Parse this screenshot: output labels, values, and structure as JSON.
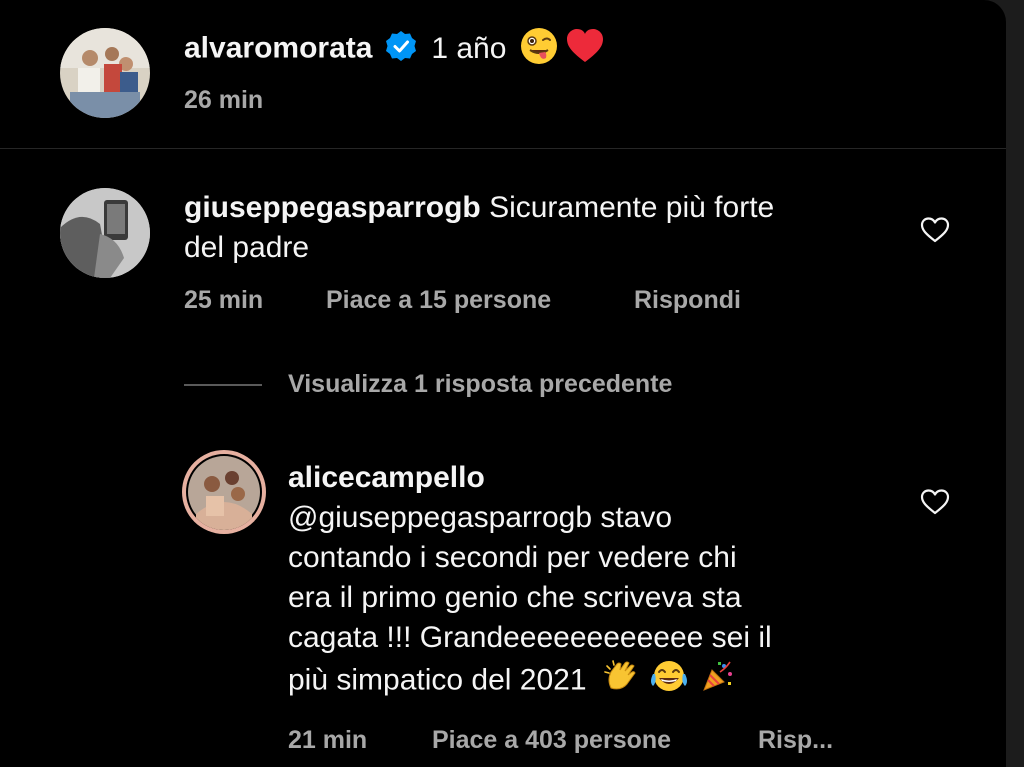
{
  "caption": {
    "username": "alvaromorata",
    "text": "1 año",
    "time": "26 min",
    "icons": [
      "verified-badge-icon",
      "winking-tongue-emoji",
      "red-heart-emoji"
    ]
  },
  "comments": [
    {
      "username": "giuseppegasparrogb",
      "text_line1": "Sicuramente più forte",
      "text_line2": "del padre",
      "time": "25 min",
      "likes": "Piace a 15 persone",
      "reply": "Rispondi"
    }
  ],
  "replies_toggle": "Visualizza 1 risposta precedente",
  "reply": {
    "username": "alicecampello",
    "lines": [
      "@giuseppegasparrogb stavo",
      "contando i secondi per vedere chi",
      "era il primo genio che scriveva sta",
      "cagata !!! Grandeeeeeeeeeeee sei il",
      "più simpatico del 2021"
    ],
    "emojis": [
      "clapping-hands-emoji",
      "tears-of-joy-emoji",
      "party-popper-emoji"
    ],
    "time": "21 min",
    "likes": "Piace a 403 persone",
    "reply": "Risp..."
  },
  "colors": {
    "background": "#000000",
    "text_primary": "#f5f5f5",
    "text_secondary": "#a8a8a8",
    "verified_blue": "#0095f6",
    "heart_red": "#ed2a3a",
    "story_ring": "#e0b0a0"
  }
}
